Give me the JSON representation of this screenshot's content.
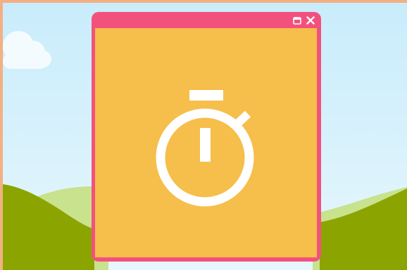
{
  "window": {
    "title_bar_color": "#f3517d",
    "content_color": "#f6be4a",
    "buttons": [
      {
        "name": "maximize",
        "icon": "maximize-icon"
      },
      {
        "name": "close",
        "icon": "close-icon"
      }
    ],
    "content_icon": "stopwatch-icon"
  },
  "scene": {
    "sky_color": "#d3f0fc",
    "hill_front_color": "#8ca400",
    "hill_back_color": "#c8e28d",
    "cloud_color": "#ffffff",
    "frame_color": "#f3b083"
  }
}
